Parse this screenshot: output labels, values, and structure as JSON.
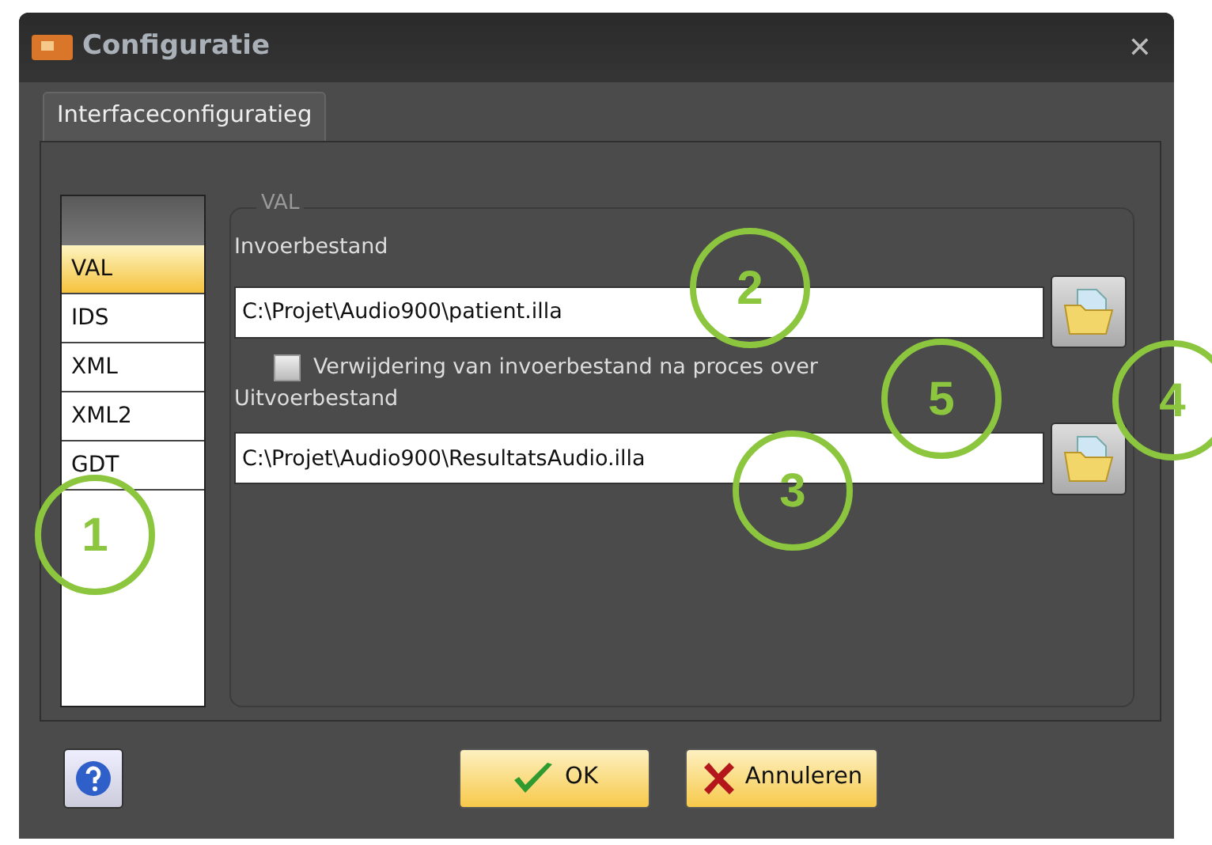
{
  "window": {
    "title": "Configuratie",
    "close": "✕"
  },
  "tabs": [
    {
      "label": "Interfaceconfiguratieg",
      "selected": true
    }
  ],
  "formats": [
    {
      "label": "VAL",
      "selected": true
    },
    {
      "label": "IDS",
      "selected": false
    },
    {
      "label": "XML",
      "selected": false
    },
    {
      "label": "XML2",
      "selected": false
    },
    {
      "label": "GDT",
      "selected": false
    }
  ],
  "group": {
    "title": "VAL",
    "input_label": "Invoerbestand",
    "input_value": "C:\\Projet\\Audio900\\patient.illa",
    "checkbox": {
      "label": "Verwijdering van invoerbestand na proces over",
      "checked": false
    },
    "output_label": "Uitvoerbestand",
    "output_value": "C:\\Projet\\Audio900\\ResultatsAudio.illa"
  },
  "buttons": [
    {
      "kind": "help"
    },
    {
      "kind": "ok",
      "label": "OK"
    },
    {
      "kind": "cancel",
      "label": "Annuleren"
    }
  ],
  "annotations": [
    {
      "label": "1"
    },
    {
      "label": "2"
    },
    {
      "label": "3"
    },
    {
      "label": "4"
    },
    {
      "label": "5"
    }
  ]
}
